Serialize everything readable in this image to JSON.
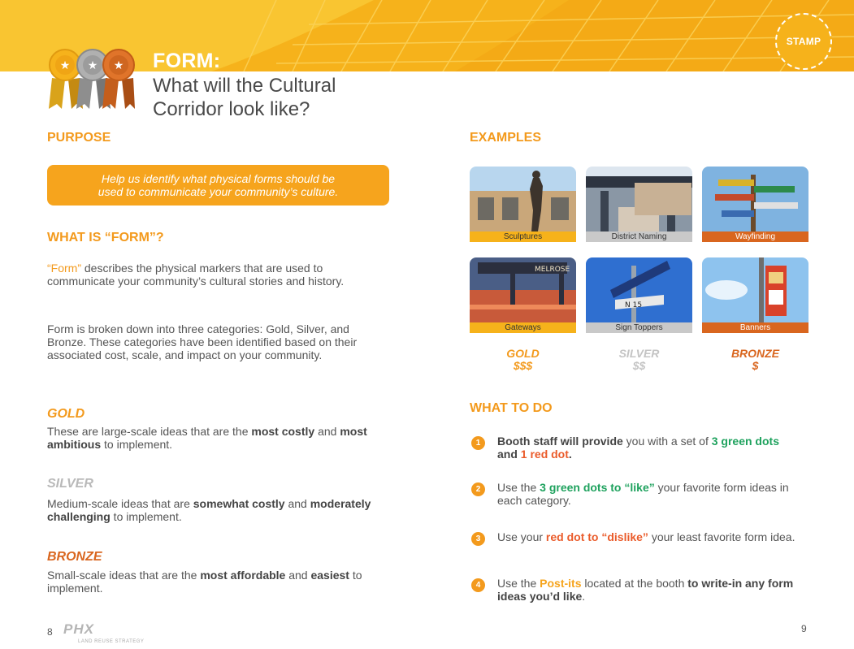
{
  "banner": {
    "stamp": "STAMP",
    "form_label": "FORM:",
    "title": "What will the Cultural Corridor look like?"
  },
  "colors": {
    "gold": "#f39a1d",
    "banner_yellow": "#f6b21b",
    "bronze": "#d9661f",
    "silver": "#c4c4c4",
    "green": "#1fa25e",
    "red": "#ea5b2a"
  },
  "purpose": {
    "heading": "PURPOSE",
    "box_line1": "Help us identify what physical forms should be",
    "box_line2": "used to communicate your community’s culture."
  },
  "what_is": {
    "heading": "WHAT IS “FORM”?",
    "p1_lead": "“Form”",
    "p1_rest": " describes the physical markers that are used to communicate your community’s cultural stories and history.",
    "p2": "Form is broken down into three categories: Gold, Silver, and Bronze. These categories have been identified based on their associated cost, scale, and impact on your community."
  },
  "categories": {
    "gold": {
      "heading": "GOLD",
      "t1": "These are large-scale ideas that are the ",
      "b1": "most costly",
      "t2": " and ",
      "b2": "most ambitious",
      "t3": " to implement."
    },
    "silver": {
      "heading": "SILVER",
      "t1": "Medium-scale ideas that are ",
      "b1": "somewhat costly",
      "t2": " and ",
      "b2": "moderately challenging",
      "t3": " to implement."
    },
    "bronze": {
      "heading": "BRONZE",
      "t1": "Small-scale ideas that are the ",
      "b1": "most affordable",
      "t2": " and ",
      "b2": "easiest",
      "t3": " to implement."
    }
  },
  "examples": {
    "heading": "EXAMPLES",
    "items": [
      {
        "caption": "Sculptures",
        "tier": "gold"
      },
      {
        "caption": "District Naming",
        "tier": "silver"
      },
      {
        "caption": "Wayfinding",
        "tier": "bronze"
      },
      {
        "caption": "Gateways",
        "tier": "gold"
      },
      {
        "caption": "Sign Toppers",
        "tier": "silver"
      },
      {
        "caption": "Banners",
        "tier": "bronze"
      }
    ],
    "tiers": {
      "gold": {
        "name": "GOLD",
        "cost": "$$$"
      },
      "silver": {
        "name": "SILVER",
        "cost": "$$"
      },
      "bronze": {
        "name": "BRONZE",
        "cost": "$"
      }
    }
  },
  "what_to_do": {
    "heading": "WHAT TO DO",
    "steps": [
      {
        "num": "1",
        "a": "Booth staff will provide",
        "b": " you with a set of ",
        "c": "3 green dots",
        "d": " and ",
        "e": "1 red dot",
        "f": "."
      },
      {
        "num": "2",
        "a": "Use the ",
        "b": "3 green dots to “like”",
        "c": " your favorite form ideas in each category."
      },
      {
        "num": "3",
        "a": "Use your ",
        "b": "red dot to “dislike”",
        "c": " your least favorite form idea."
      },
      {
        "num": "4",
        "a": "Use the ",
        "b": "Post-its",
        "c": " located at the booth ",
        "d": "to write-in any form ideas you’d like",
        "e": "."
      }
    ]
  },
  "footer": {
    "page_left": "8",
    "page_right": "9",
    "logo": "PHX",
    "logo_sub": "LAND REUSE STRATEGY"
  }
}
